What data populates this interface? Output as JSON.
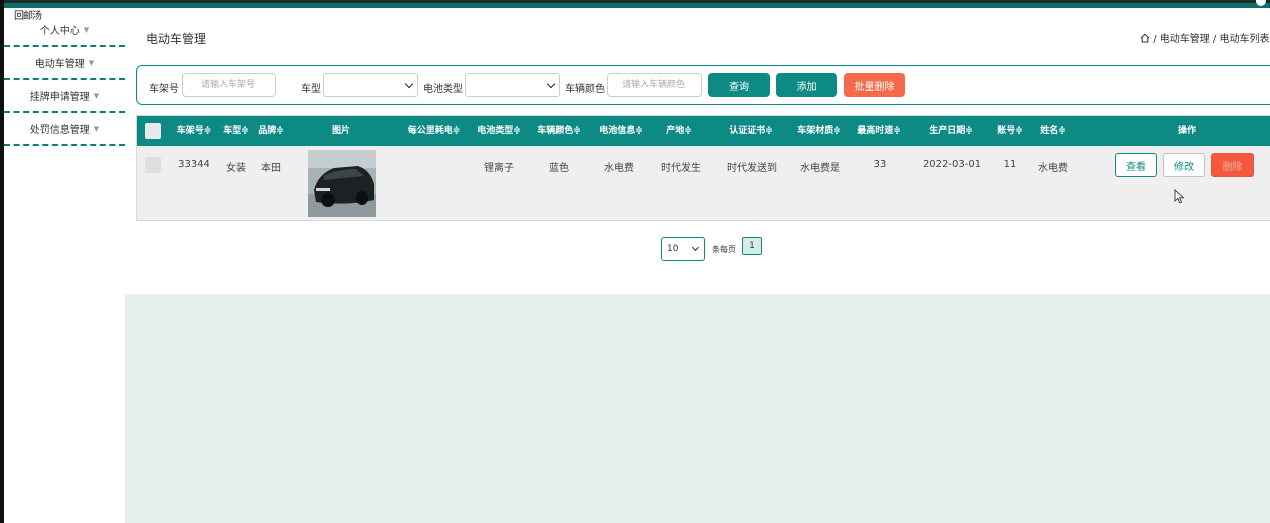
{
  "app": {
    "logo_text": "回邮汤"
  },
  "sidebar": {
    "items": [
      {
        "label": "个人中心"
      },
      {
        "label": "电动车管理"
      },
      {
        "label": "挂牌申请管理"
      },
      {
        "label": "处罚信息管理"
      }
    ]
  },
  "page": {
    "title": "电动车管理",
    "breadcrumb": "/ 电动车管理 / 电动车列表"
  },
  "search": {
    "frame_label": "车架号",
    "frame_placeholder": "请输入车架号",
    "type_label": "车型",
    "battery_label": "电池类型",
    "color_label": "车辆颜色",
    "color_placeholder": "请输入车辆颜色",
    "query_button": "查询",
    "add_button": "添加",
    "batch_delete_button": "批量删除"
  },
  "table": {
    "headers": [
      "车架号≑",
      "车型≑",
      "品牌≑",
      "图片",
      "每公里耗电≑",
      "电池类型≑",
      "车辆颜色≑",
      "电池信息≑",
      "产地≑",
      "认证证书≑",
      "车架材质≑",
      "最高时速≑",
      "生产日期≑",
      "账号≑",
      "姓名≑",
      "操作"
    ],
    "rows": [
      {
        "frame_no": "33344",
        "model": "女装",
        "brand": "本田",
        "power": "",
        "battery_type": "锂离子",
        "color": "蓝色",
        "battery_info": "水电费",
        "origin": "时代发生",
        "certificate": "时代发送到",
        "frame_material": "水电费是",
        "max_speed": "33",
        "production_date": "2022-03-01",
        "account": "11",
        "name": "水电费",
        "view": "查看",
        "edit": "修改",
        "delete": "删除"
      }
    ]
  },
  "pager": {
    "page_size": "10",
    "per_page_label": "条每页",
    "current_page": "1"
  },
  "colors": {
    "accent": "#0e8a84",
    "danger": "#f56a4a"
  }
}
